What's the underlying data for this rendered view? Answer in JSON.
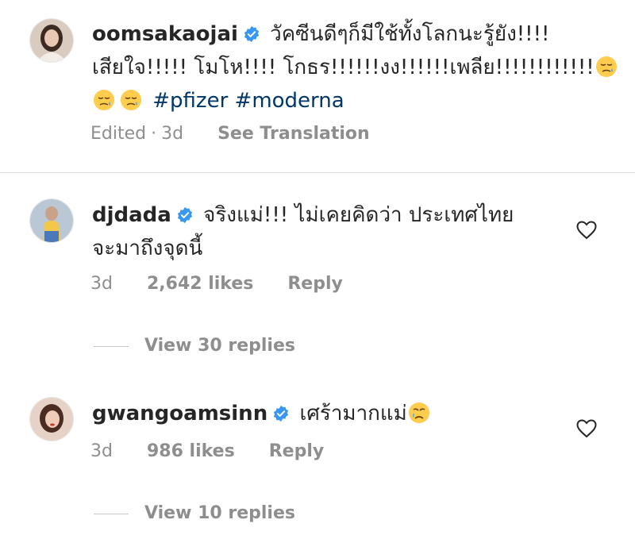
{
  "comments": [
    {
      "username": "oomsakaojai",
      "line1": "วัคซีนดีๆก็มีใช้ทั้งโลกนะรู้ยัง!!!!",
      "line2": "เสียใจ!!!!! โมโห!!!! โกธร!!!!!!งง!!!!!!เพลีย!!!!!!!!!!!!",
      "hashtags": "#pfizer #moderna",
      "edited": "Edited",
      "separator": "·",
      "time": "3d",
      "see_translation": "See Translation",
      "emoji_icon": "sad-relieved-face-icon"
    },
    {
      "username": "djdada",
      "line1": "จริงแม่!!! ไม่เคยคิดว่า ประเทศไทย",
      "line2": "จะมาถึงจุดนี้",
      "time": "3d",
      "likes": "2,642 likes",
      "reply": "Reply",
      "view_replies": "View 30 replies"
    },
    {
      "username": "gwangoamsinn",
      "line1": "เศร้ามากแม่",
      "time": "3d",
      "likes": "986 likes",
      "reply": "Reply",
      "view_replies": "View 10 replies",
      "emoji_icon": "crying-face-icon"
    }
  ],
  "colors": {
    "text": "#262626",
    "secondary": "#8e8e8e",
    "hashtag": "#00376b",
    "verified": "#3897f0",
    "divider": "#dbdbdb"
  },
  "icons": {
    "verified": "verified-badge-icon",
    "like": "heart-outline-icon"
  }
}
